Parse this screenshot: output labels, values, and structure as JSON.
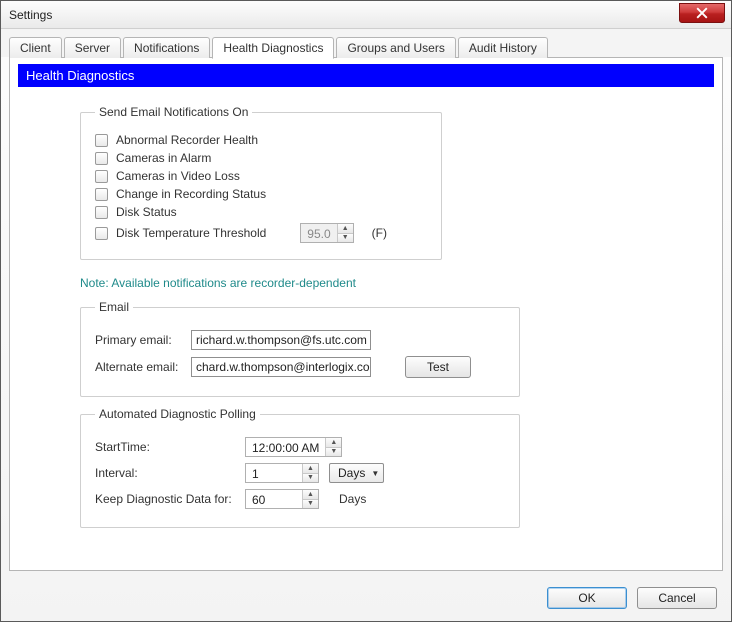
{
  "window": {
    "title": "Settings"
  },
  "tabs": [
    {
      "label": "Client"
    },
    {
      "label": "Server"
    },
    {
      "label": "Notifications"
    },
    {
      "label": "Health Diagnostics"
    },
    {
      "label": "Groups and Users"
    },
    {
      "label": "Audit History"
    }
  ],
  "banner": "Health Diagnostics",
  "notify": {
    "legend": "Send Email Notifications On",
    "items": [
      "Abnormal Recorder Health",
      "Cameras in Alarm",
      "Cameras in Video Loss",
      "Change in Recording Status",
      "Disk Status",
      "Disk Temperature Threshold"
    ],
    "threshold_value": "95.0",
    "threshold_unit": "(F)"
  },
  "note": "Note: Available notifications are recorder-dependent",
  "email": {
    "legend": "Email",
    "primary_label": "Primary email:",
    "primary_value": "richard.w.thompson@fs.utc.com",
    "alternate_label": "Alternate email:",
    "alternate_value": "chard.w.thompson@interlogix.com",
    "test_label": "Test"
  },
  "poll": {
    "legend": "Automated Diagnostic Polling",
    "start_label": "StartTime:",
    "start_value": "12:00:00 AM",
    "interval_label": "Interval:",
    "interval_value": "1",
    "interval_unit": "Days",
    "keep_label": "Keep Diagnostic Data for:",
    "keep_value": "60",
    "keep_unit": "Days"
  },
  "footer": {
    "ok": "OK",
    "cancel": "Cancel"
  }
}
